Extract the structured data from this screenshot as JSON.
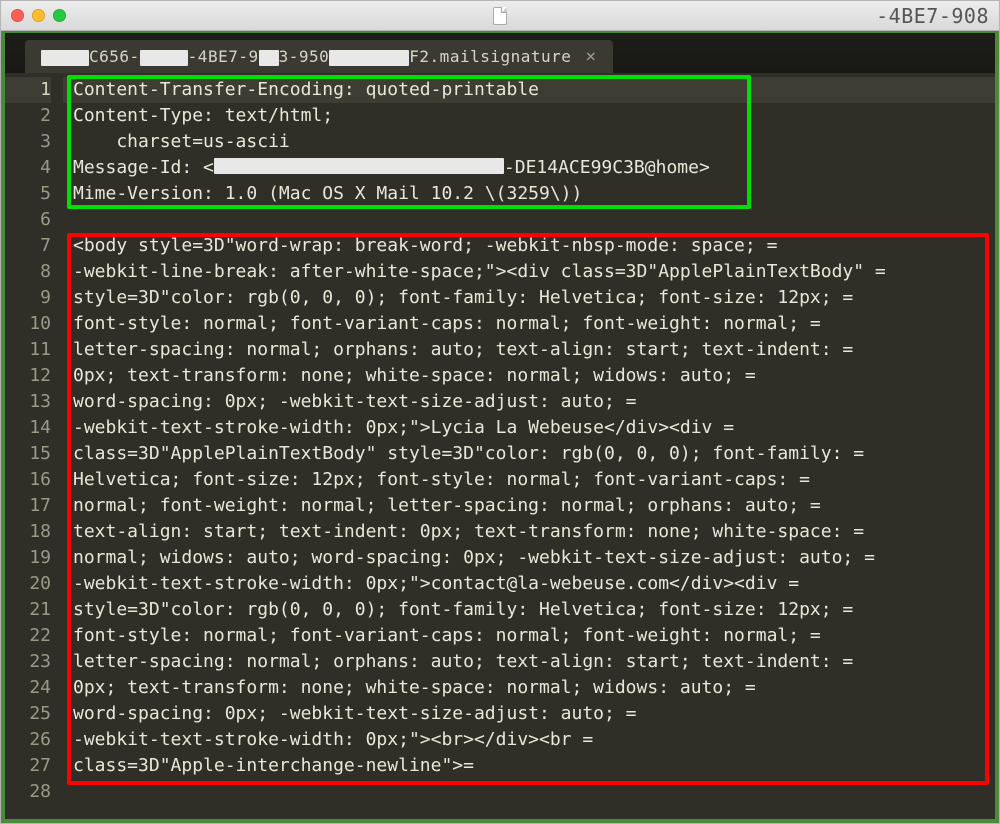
{
  "titlebar": {
    "right_text": "-4BE7-908"
  },
  "tab": {
    "seg1": "C656-",
    "seg2": "-4BE7-9",
    "seg3": "3-950",
    "seg4": "F2.mailsignature"
  },
  "lines": [
    "Content-Transfer-Encoding: quoted-printable",
    "Content-Type: text/html;",
    "    charset=us-ascii",
    "",
    "Mime-Version: 1.0 (Mac OS X Mail 10.2 \\(3259\\))",
    "",
    "<body style=3D\"word-wrap: break-word; -webkit-nbsp-mode: space; =",
    "-webkit-line-break: after-white-space;\"><div class=3D\"ApplePlainTextBody\" =",
    "style=3D\"color: rgb(0, 0, 0); font-family: Helvetica; font-size: 12px; =",
    "font-style: normal; font-variant-caps: normal; font-weight: normal; =",
    "letter-spacing: normal; orphans: auto; text-align: start; text-indent: =",
    "0px; text-transform: none; white-space: normal; widows: auto; =",
    "word-spacing: 0px; -webkit-text-size-adjust: auto; =",
    "-webkit-text-stroke-width: 0px;\">Lycia La Webeuse</div><div =",
    "class=3D\"ApplePlainTextBody\" style=3D\"color: rgb(0, 0, 0); font-family: =",
    "Helvetica; font-size: 12px; font-style: normal; font-variant-caps: =",
    "normal; font-weight: normal; letter-spacing: normal; orphans: auto; =",
    "text-align: start; text-indent: 0px; text-transform: none; white-space: =",
    "normal; widows: auto; word-spacing: 0px; -webkit-text-size-adjust: auto; =",
    "-webkit-text-stroke-width: 0px;\">contact@la-webeuse.com</div><div =",
    "style=3D\"color: rgb(0, 0, 0); font-family: Helvetica; font-size: 12px; =",
    "font-style: normal; font-variant-caps: normal; font-weight: normal; =",
    "letter-spacing: normal; orphans: auto; text-align: start; text-indent: =",
    "0px; text-transform: none; white-space: normal; widows: auto; =",
    "word-spacing: 0px; -webkit-text-size-adjust: auto; =",
    "-webkit-text-stroke-width: 0px;\"><br></div><br =",
    "class=3D\"Apple-interchange-newline\">=",
    ""
  ],
  "line4": {
    "prefix": "Message-Id: <",
    "suffix": "-DE14ACE99C3B@home>"
  },
  "line_count": 28
}
